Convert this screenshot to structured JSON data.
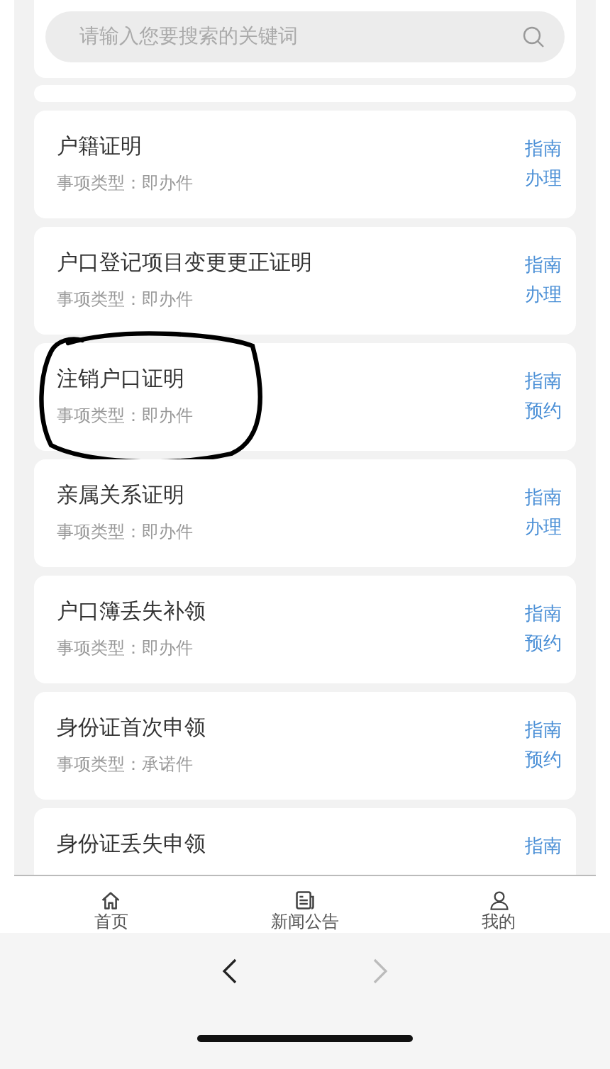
{
  "search": {
    "placeholder": "请输入您要搜索的关键词"
  },
  "items": [
    {
      "title": "户籍证明",
      "type": "事项类型：即办件",
      "links": [
        "指南",
        "办理"
      ],
      "circled": false
    },
    {
      "title": "户口登记项目变更更正证明",
      "type": "事项类型：即办件",
      "links": [
        "指南",
        "办理"
      ],
      "circled": false
    },
    {
      "title": "注销户口证明",
      "type": "事项类型：即办件",
      "links": [
        "指南",
        "预约"
      ],
      "circled": true
    },
    {
      "title": "亲属关系证明",
      "type": "事项类型：即办件",
      "links": [
        "指南",
        "办理"
      ],
      "circled": false
    },
    {
      "title": "户口簿丢失补领",
      "type": "事项类型：即办件",
      "links": [
        "指南",
        "预约"
      ],
      "circled": false
    },
    {
      "title": "身份证首次申领",
      "type": "事项类型：承诺件",
      "links": [
        "指南",
        "预约"
      ],
      "circled": false
    },
    {
      "title": "身份证丢失申领",
      "links": [
        "指南"
      ],
      "circled": false
    }
  ],
  "tabbar": [
    {
      "label": "首页",
      "kind": "home"
    },
    {
      "label": "新闻公告",
      "kind": "news"
    },
    {
      "label": "我的",
      "kind": "user"
    }
  ],
  "browser": {
    "back_disabled": false,
    "forward_disabled": true
  }
}
